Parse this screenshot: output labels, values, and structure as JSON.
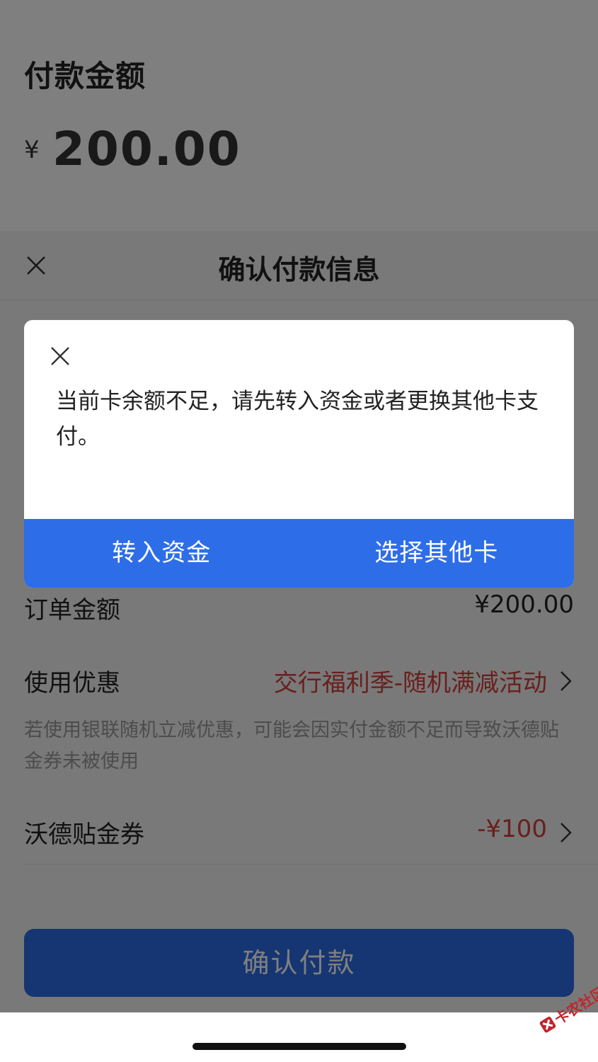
{
  "payment": {
    "label": "付款金额",
    "currency": "¥",
    "amount": "200.00"
  },
  "sheet": {
    "title": "确认付款信息",
    "order_label": "订单金额",
    "order_value": "¥200.00",
    "discount_label": "使用优惠",
    "discount_value": "交行福利季-随机满减活动",
    "note": "若使用银联随机立减优惠，可能会因实付金额不足而导致沃德贴金券未被使用",
    "coupon_label": "沃德贴金券",
    "coupon_value": "-¥100",
    "confirm_button": "确认付款"
  },
  "dialog": {
    "message": "当前卡余额不足，请先转入资金或者更换其他卡支付。",
    "transfer_button": "转入资金",
    "other_card_button": "选择其他卡"
  },
  "watermark": {
    "text": "卡农社区"
  },
  "colors": {
    "primary_blue": "#2d6de8",
    "discount_red": "#d0403a",
    "overlay": "rgba(0,0,0,0.5)"
  },
  "icons": [
    "close-icon",
    "chevron-right-icon",
    "watermark-logo-icon"
  ]
}
